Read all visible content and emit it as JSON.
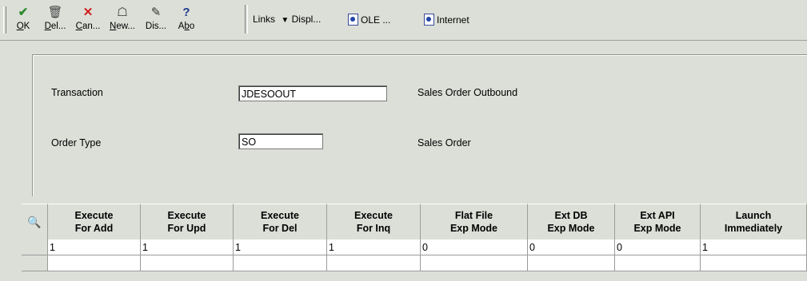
{
  "toolbar": {
    "buttons": [
      {
        "key": "O",
        "label_rest": "K",
        "icon": "✔",
        "color": "#2e8b2e"
      },
      {
        "key": "D",
        "label_rest": "el...",
        "icon": "🗑",
        "color": "#333"
      },
      {
        "key": "C",
        "label_rest": "an...",
        "icon": "✕",
        "color": "#d02020"
      },
      {
        "key": "N",
        "label_rest": "ew...",
        "icon": "☖",
        "color": "#333"
      },
      {
        "key": "",
        "label_rest": "Dis...",
        "icon": "✎",
        "color": "#333"
      },
      {
        "key": "",
        "label_rest": "Abo",
        "icon": "?",
        "color": "#1a3a8a"
      }
    ],
    "links_label": "Links",
    "display_label": "Displ...",
    "ole_label": "OLE ...",
    "internet_label": "Internet"
  },
  "form": {
    "transaction_label": "Transaction",
    "transaction_value": "JDESOOUT",
    "transaction_desc": "Sales Order Outbound",
    "order_type_label": "Order Type",
    "order_type_value": "SO",
    "order_type_desc": "Sales Order"
  },
  "grid": {
    "columns": [
      "Execute\nFor Add",
      "Execute\nFor Upd",
      "Execute\nFor Del",
      "Execute\nFor Inq",
      "Flat File\nExp Mode",
      "Ext DB\nExp Mode",
      "Ext API\nExp Mode",
      "Launch\nImmediately"
    ],
    "rows": [
      [
        "1",
        "1",
        "1",
        "1",
        "0",
        "0",
        "0",
        "1"
      ],
      [
        "",
        "",
        "",
        "",
        "",
        "",
        "",
        ""
      ]
    ]
  }
}
